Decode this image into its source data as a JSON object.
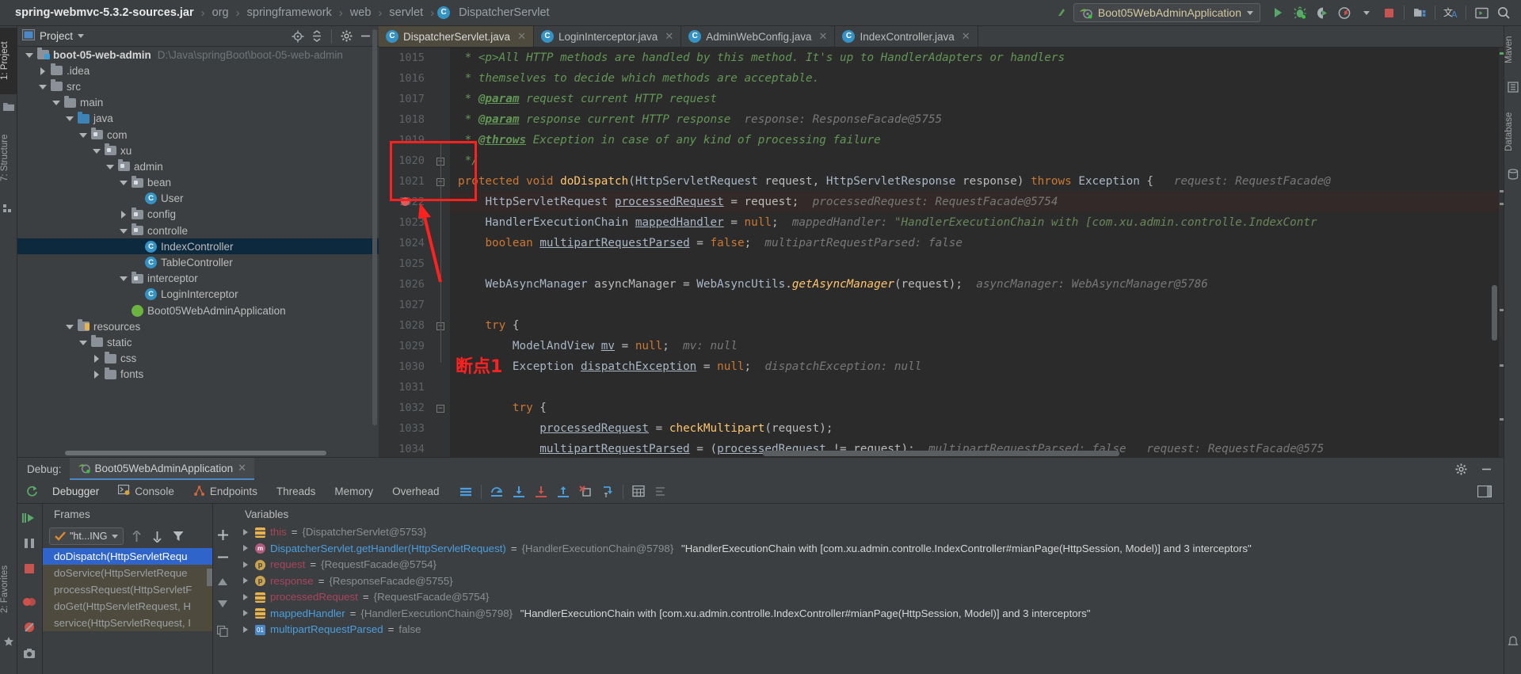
{
  "breadcrumb": {
    "root": "spring-webmvc-5.3.2-sources.jar",
    "items": [
      "org",
      "springframework",
      "web",
      "servlet"
    ],
    "class": "DispatcherServlet",
    "sep": "›"
  },
  "toolbar": {
    "run_config": "Boot05WebAdminApplication",
    "icons": [
      "back-arrow-icon",
      "run-icon",
      "debug-icon",
      "run-with-coverage-icon",
      "profiler-icon",
      "stop-icon",
      "project-structure-icon",
      "translate-icon",
      "terminal-icon",
      "search-icon"
    ]
  },
  "left_strip": {
    "tabs": [
      "1: Project",
      "7: Structure",
      "2: Favorites"
    ]
  },
  "right_strip": {
    "tabs": [
      "Maven",
      "Database",
      "Notifications"
    ]
  },
  "project": {
    "title": "Project",
    "header_icons": [
      "locate-icon",
      "collapse-all-icon",
      "settings-icon",
      "hide-icon"
    ],
    "tree": [
      {
        "depth": 0,
        "arrow": "open",
        "icon": "module-folder",
        "label": "boot-05-web-admin",
        "bold": true,
        "path": "D:\\Java\\springBoot\\boot-05-web-admin",
        "selected": false
      },
      {
        "depth": 1,
        "arrow": "closed",
        "icon": "folder",
        "label": ".idea",
        "selected": false
      },
      {
        "depth": 1,
        "arrow": "open",
        "icon": "folder",
        "label": "src",
        "selected": false
      },
      {
        "depth": 2,
        "arrow": "open",
        "icon": "folder",
        "label": "main",
        "selected": false
      },
      {
        "depth": 3,
        "arrow": "open",
        "icon": "folder-blue",
        "label": "java",
        "selected": false
      },
      {
        "depth": 4,
        "arrow": "open",
        "icon": "package",
        "label": "com",
        "selected": false
      },
      {
        "depth": 5,
        "arrow": "open",
        "icon": "package",
        "label": "xu",
        "selected": false
      },
      {
        "depth": 6,
        "arrow": "open",
        "icon": "package",
        "label": "admin",
        "selected": false
      },
      {
        "depth": 7,
        "arrow": "open",
        "icon": "package",
        "label": "bean",
        "selected": false
      },
      {
        "depth": 8,
        "arrow": "none",
        "icon": "class",
        "label": "User",
        "selected": false
      },
      {
        "depth": 7,
        "arrow": "closed",
        "icon": "package",
        "label": "config",
        "selected": false
      },
      {
        "depth": 7,
        "arrow": "open",
        "icon": "package",
        "label": "controlle",
        "selected": false
      },
      {
        "depth": 8,
        "arrow": "none",
        "icon": "class",
        "label": "IndexController",
        "selected": true
      },
      {
        "depth": 8,
        "arrow": "none",
        "icon": "class",
        "label": "TableController",
        "selected": false
      },
      {
        "depth": 7,
        "arrow": "open",
        "icon": "package",
        "label": "interceptor",
        "selected": false
      },
      {
        "depth": 8,
        "arrow": "none",
        "icon": "class",
        "label": "LoginInterceptor",
        "selected": false
      },
      {
        "depth": 7,
        "arrow": "none",
        "icon": "spring",
        "label": "Boot05WebAdminApplication",
        "selected": false
      },
      {
        "depth": 3,
        "arrow": "open",
        "icon": "folder-res",
        "label": "resources",
        "selected": false
      },
      {
        "depth": 4,
        "arrow": "open",
        "icon": "folder",
        "label": "static",
        "selected": false
      },
      {
        "depth": 5,
        "arrow": "closed",
        "icon": "folder",
        "label": "css",
        "selected": false
      },
      {
        "depth": 5,
        "arrow": "closed",
        "icon": "folder",
        "label": "fonts",
        "selected": false
      }
    ]
  },
  "editor": {
    "tabs": [
      {
        "label": "DispatcherServlet.java",
        "active": true
      },
      {
        "label": "LoginInterceptor.java",
        "active": false
      },
      {
        "label": "AdminWebConfig.java",
        "active": false
      },
      {
        "label": "IndexController.java",
        "active": false
      }
    ],
    "lines": [
      {
        "n": "1015",
        "html": "<span class=\"cmt\"> * &lt;p&gt;All HTTP methods are handled by this method. It's up to HandlerAdapters or handlers</span>"
      },
      {
        "n": "1016",
        "html": "<span class=\"cmt\"> * themselves to decide which methods are acceptable.</span>"
      },
      {
        "n": "1017",
        "html": "<span class=\"cmt\"> * </span><span class=\"tag\">@param</span><span class=\"cmt\"> request current HTTP request</span>"
      },
      {
        "n": "1018",
        "html": "<span class=\"cmt\"> * </span><span class=\"tag\">@param</span><span class=\"cmt\"> response current HTTP response</span><span class=\"hint\">  response: ResponseFacade@5755</span>"
      },
      {
        "n": "1019",
        "html": "<span class=\"cmt\"> * </span><span class=\"tag\">@throws</span><span class=\"cmt\"> Exception in case of any kind of processing failure</span>"
      },
      {
        "n": "1020",
        "html": "<span class=\"cmt\"> */</span>",
        "fold": true
      },
      {
        "n": "1021",
        "html": "<span class=\"kw\">protected</span> <span class=\"kw\">void</span> <span class=\"mth\">doDispatch</span>(<span class=\"typ\">HttpServletRequest</span> request, <span class=\"typ\">HttpServletResponse</span> response) <span class=\"kw\">throws</span> <span class=\"typ\">Exception</span> { <span class=\"hint\">  request: RequestFacade@</span>",
        "fold": true
      },
      {
        "n": "1022",
        "html": "    <span class=\"typ\">HttpServletRequest</span> <span class=\"fld\">processedRequest</span> = request;  <span class=\"hint\">processedRequest: RequestFacade@5754</span>",
        "highlight": true,
        "breakpoint": true
      },
      {
        "n": "1023",
        "html": "    <span class=\"typ\">HandlerExecutionChain</span> <span class=\"fld\">mappedHandler</span> = <span class=\"kw\">null</span>;  <span class=\"hint\">mappedHandler: </span><span class=\"str\">\"HandlerExecutionChain with [com.xu.admin.controlle.IndexContr</span>"
      },
      {
        "n": "1024",
        "html": "    <span class=\"kw\">boolean</span> <span class=\"fld\">multipartRequestParsed</span> = <span class=\"kw\">false</span>;  <span class=\"hint\">multipartRequestParsed: false</span>"
      },
      {
        "n": "1025",
        "html": ""
      },
      {
        "n": "1026",
        "html": "    <span class=\"typ\">WebAsyncManager</span> asyncManager = <span class=\"typ\">WebAsyncUtils</span>.<span class=\"mth\" style=\"font-style:italic\">getAsyncManager</span>(request);  <span class=\"hint\">asyncManager: WebAsyncManager@5786</span>"
      },
      {
        "n": "1027",
        "html": ""
      },
      {
        "n": "1028",
        "html": "    <span class=\"kw\">try</span> {",
        "fold": true
      },
      {
        "n": "1029",
        "html": "        <span class=\"typ\">ModelAndView</span> <span class=\"fld\">mv</span> = <span class=\"kw\">null</span>;  <span class=\"hint\">mv: null</span>"
      },
      {
        "n": "1030",
        "html": "        <span class=\"typ\">Exception</span> <span class=\"fld\">dispatchException</span> = <span class=\"kw\">null</span>;  <span class=\"hint\">dispatchException: null</span>"
      },
      {
        "n": "1031",
        "html": ""
      },
      {
        "n": "1032",
        "html": "        <span class=\"kw\">try</span> {",
        "fold": true
      },
      {
        "n": "1033",
        "html": "            <span class=\"fld\">processedRequest</span> = <span class=\"mth\">checkMultipart</span>(request);"
      },
      {
        "n": "1034",
        "html": "            <span class=\"fld\">multipartRequestParsed</span> = (<span class=\"fld\">processedRequest</span> != request);  <span class=\"hint\">multipartRequestParsed: false   request: RequestFacade@575</span>"
      }
    ],
    "annotation": "断点1"
  },
  "debug": {
    "label": "Debug:",
    "session_tab": "Boot05WebAdminApplication",
    "tabs": [
      {
        "label": "Debugger",
        "icon": "debugger-icon",
        "active": true
      },
      {
        "label": "Console",
        "icon": "console-icon",
        "active": false
      },
      {
        "label": "Endpoints",
        "icon": "endpoints-icon",
        "active": false
      },
      {
        "label": "Threads",
        "icon": "threads-icon",
        "active": false
      },
      {
        "label": "Memory",
        "icon": "memory-icon",
        "active": false
      },
      {
        "label": "Overhead",
        "icon": "overhead-icon",
        "active": false
      }
    ],
    "step_icons": [
      "layout-icon",
      "step-over-icon",
      "step-into-icon",
      "force-step-into-icon",
      "step-out-icon",
      "drop-frame-icon",
      "run-to-cursor-icon",
      "evaluate-icon",
      "mute-breakpoints-icon"
    ],
    "frames": {
      "title": "Frames",
      "thread": "\"ht...ING",
      "rows": [
        {
          "label": "doDispatch(HttpServletRequ",
          "selected": true
        },
        {
          "label": "doService(HttpServletReque",
          "lib": true
        },
        {
          "label": "processRequest(HttpServletF",
          "lib": true
        },
        {
          "label": "doGet(HttpServletRequest, H",
          "lib": true
        },
        {
          "label": "service(HttpServletRequest, I",
          "lib": true
        }
      ]
    },
    "variables": {
      "title": "Variables",
      "rows": [
        {
          "icon": "field",
          "name": "this",
          "eq": " = ",
          "value": "{DispatcherServlet@5753}",
          "str": "",
          "blue": false
        },
        {
          "icon": "method",
          "name": "DispatcherServlet.getHandler(HttpServletRequest)",
          "eq": " = ",
          "value": "{HandlerExecutionChain@5798}",
          "str": "\"HandlerExecutionChain with [com.xu.admin.controlle.IndexController#mianPage(HttpSession, Model)] and 3 interceptors\"",
          "blue": true
        },
        {
          "icon": "param",
          "name": "request",
          "eq": " = ",
          "value": "{RequestFacade@5754}",
          "str": "",
          "blue": false
        },
        {
          "icon": "param",
          "name": "response",
          "eq": " = ",
          "value": "{ResponseFacade@5755}",
          "str": "",
          "blue": false
        },
        {
          "icon": "field",
          "name": "processedRequest",
          "eq": " = ",
          "value": "{RequestFacade@5754}",
          "str": "",
          "blue": false
        },
        {
          "icon": "field",
          "name": "mappedHandler",
          "eq": " = ",
          "value": "{HandlerExecutionChain@5798}",
          "str": "\"HandlerExecutionChain with [com.xu.admin.controlle.IndexController#mianPage(HttpSession, Model)] and 3 interceptors\"",
          "blue": true
        },
        {
          "icon": "prim",
          "name": "multipartRequestParsed",
          "eq": " = ",
          "value": "false",
          "str": "",
          "blue": true
        }
      ]
    },
    "run_controls": [
      "resume-icon",
      "pause-icon",
      "stop-icon",
      "view-breakpoints-icon",
      "mute-breakpoints-icon",
      "settings-icon"
    ]
  },
  "colors": {
    "accent_blue": "#4a88c7",
    "selection_blue": "#2f65ca",
    "tree_selection": "#0d293e",
    "annotation_red": "#ff2020",
    "editor_bg": "#2b2b2b",
    "panel_bg": "#3c3f41",
    "tab_active": "#4e4a3e"
  }
}
